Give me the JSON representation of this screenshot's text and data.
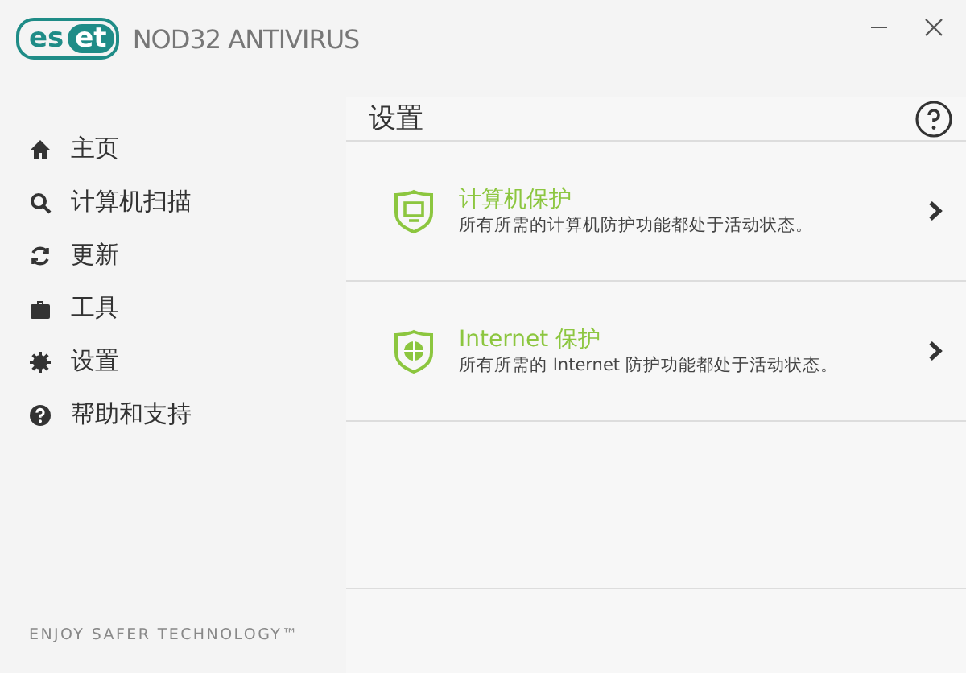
{
  "header": {
    "logo_outlined": "es",
    "logo_filled": "et",
    "product": "NOD32 ANTIVIRUS"
  },
  "sidebar": {
    "items": [
      {
        "label": "主页"
      },
      {
        "label": "计算机扫描"
      },
      {
        "label": "更新"
      },
      {
        "label": "工具"
      },
      {
        "label": "设置"
      },
      {
        "label": "帮助和支持"
      }
    ],
    "footer": "ENJOY SAFER TECHNOLOGY™"
  },
  "main": {
    "title": "设置",
    "sections": [
      {
        "title": "计算机保护",
        "description": "所有所需的计算机防护功能都处于活动状态。"
      },
      {
        "title": "Internet 保护",
        "description": "所有所需的 Internet 防护功能都处于活动状态。"
      }
    ]
  }
}
